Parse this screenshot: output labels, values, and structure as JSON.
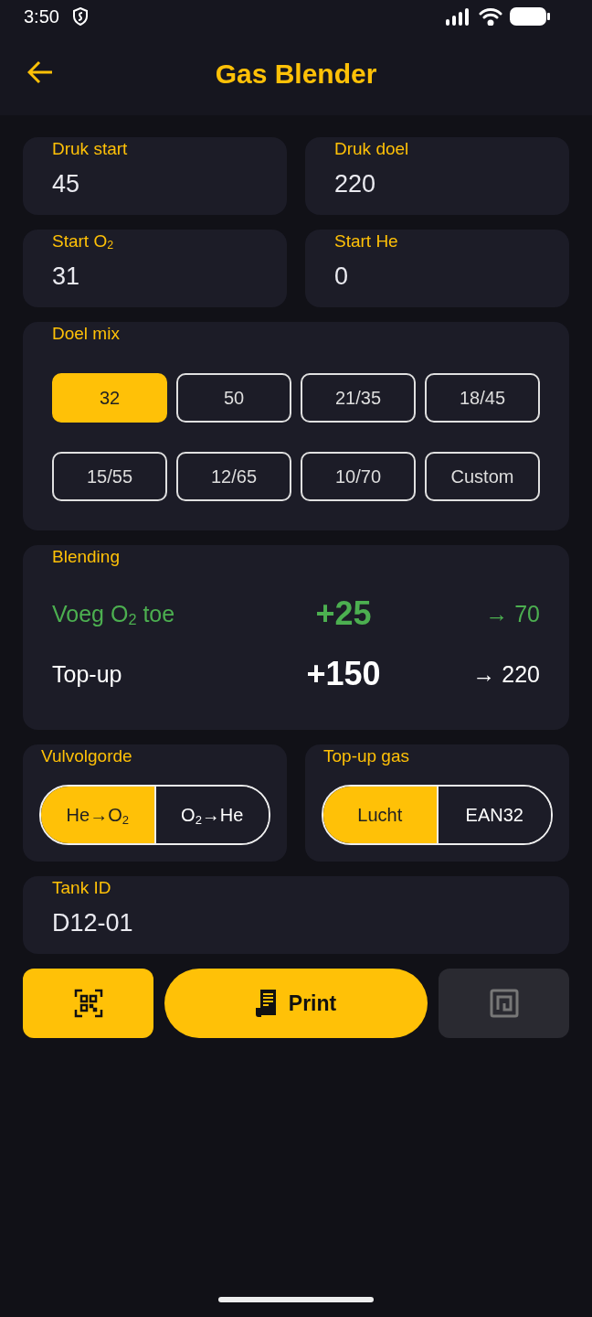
{
  "status_bar": {
    "time": "3:50"
  },
  "header": {
    "title": "Gas Blender"
  },
  "fields": [
    {
      "label": "Druk start",
      "value": "45"
    },
    {
      "label": "Druk doel",
      "value": "220"
    },
    {
      "label": "Start O$_{2}$",
      "value": "31"
    },
    {
      "label": "Start He",
      "value": "0"
    }
  ],
  "doel_mix": {
    "label": "Doel mix",
    "options": [
      {
        "label": "32",
        "selected": true
      },
      {
        "label": "50",
        "selected": false
      },
      {
        "label": "21/35",
        "selected": false
      },
      {
        "label": "18/45",
        "selected": false
      },
      {
        "label": "15/55",
        "selected": false
      },
      {
        "label": "12/65",
        "selected": false
      },
      {
        "label": "10/70",
        "selected": false
      },
      {
        "label": "Custom",
        "selected": false
      }
    ]
  },
  "blending": {
    "label": "Blending",
    "rows": [
      {
        "kind": "oxygen",
        "label": "Voeg O$_{2}$ toe",
        "amount": "+25",
        "target": "→ 70"
      },
      {
        "kind": "topup",
        "label": "Top-up",
        "amount": "+150",
        "target": "→ 220"
      }
    ]
  },
  "toggles": [
    {
      "label": "Vulvolgorde",
      "options": [
        {
          "label": "He→O$_{2}$",
          "selected": true
        },
        {
          "label": "O$_{2}$→He",
          "selected": false
        }
      ]
    },
    {
      "label": "Top-up gas",
      "options": [
        {
          "label": "Lucht",
          "selected": true
        },
        {
          "label": "EAN32",
          "selected": false
        }
      ]
    }
  ],
  "tank": {
    "label": "Tank ID",
    "value": "D12-01"
  },
  "actions": [
    {
      "kind": "scan",
      "disabled": false
    },
    {
      "kind": "print",
      "label": "Print",
      "disabled": false
    },
    {
      "kind": "nfc",
      "disabled": true
    }
  ]
}
